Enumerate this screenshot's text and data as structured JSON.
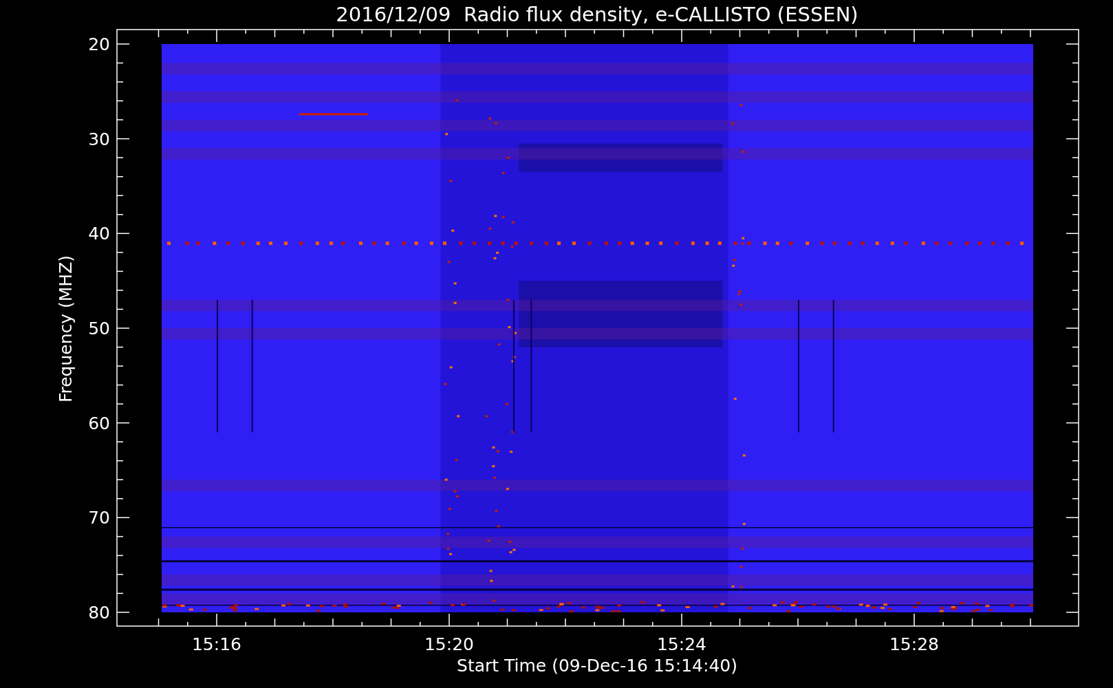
{
  "title": "2016/12/09  Radio flux density, e-CALLISTO (ESSEN)",
  "ylabel": "Frequency (MHZ)",
  "xlabel": "Start Time (09-Dec-16 15:14:40)",
  "yticks": [
    "20",
    "30",
    "40",
    "50",
    "60",
    "70",
    "80"
  ],
  "xticks": [
    "15:16",
    "15:20",
    "15:24",
    "15:28"
  ]
}
